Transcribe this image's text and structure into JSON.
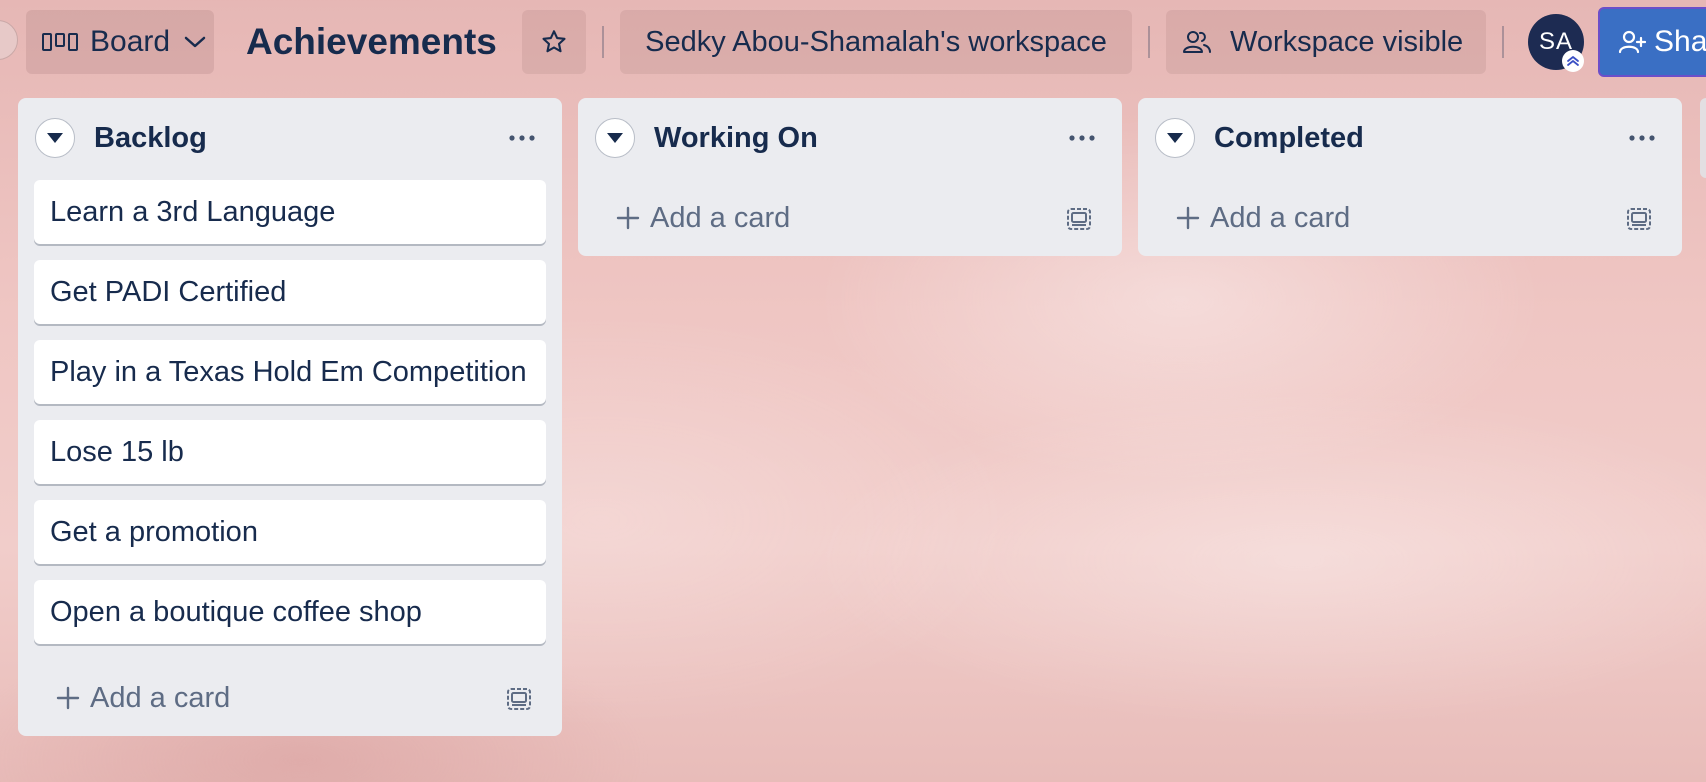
{
  "header": {
    "view_label": "Board",
    "board_title": "Achievements",
    "workspace_name": "Sedky Abou-Shamalah's workspace",
    "visibility_label": "Workspace visible",
    "avatar_initials": "SA",
    "share_label": "Sha"
  },
  "lists": [
    {
      "title": "Backlog",
      "cards": [
        "Learn a 3rd Language",
        "Get PADI Certified",
        "Play in a Texas Hold Em Competition",
        "Lose 15 lb",
        "Get a promotion",
        "Open a boutique coffee shop"
      ],
      "add_card_label": "Add a card"
    },
    {
      "title": "Working On",
      "cards": [],
      "add_card_label": "Add a card"
    },
    {
      "title": "Completed",
      "cards": [],
      "add_card_label": "Add a card"
    }
  ],
  "colors": {
    "text_primary": "#172b4d",
    "list_background": "#ebecf0",
    "share_button": "#3a6fc4",
    "avatar_background": "#1d2b52"
  }
}
